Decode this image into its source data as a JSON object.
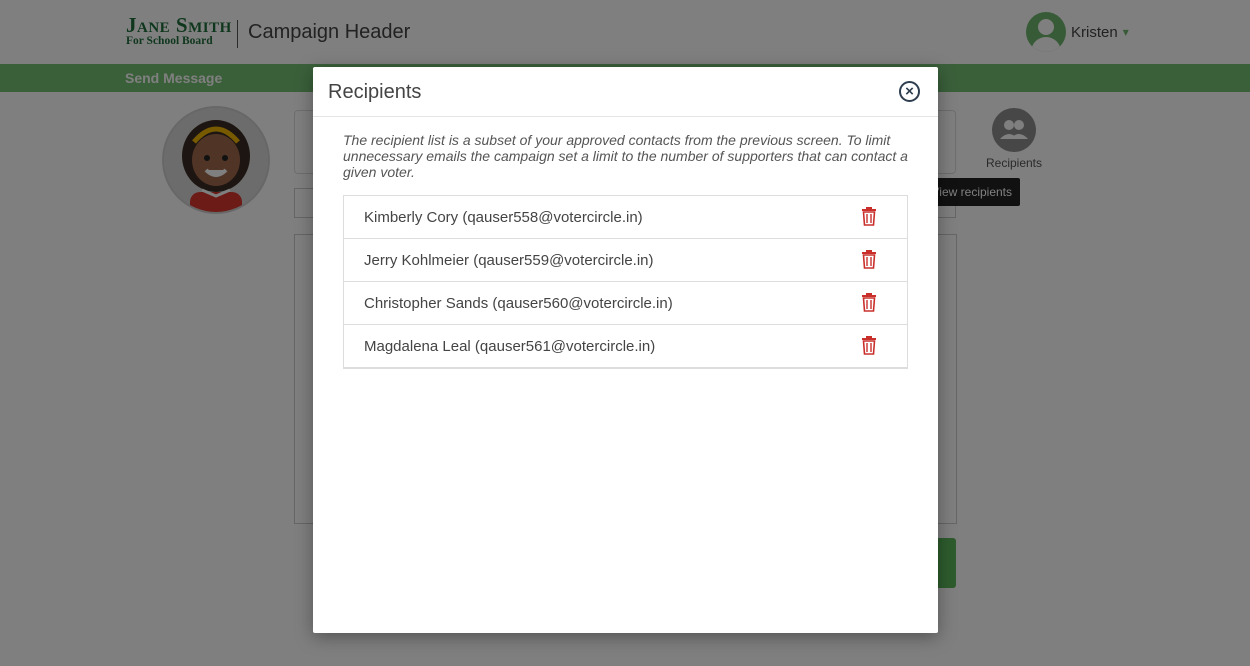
{
  "header": {
    "logo": {
      "line1": "Jane Smith",
      "line2": "For School Board",
      "color": "#1f6e3a"
    },
    "campaign_title": "Campaign Header",
    "user": {
      "name": "Kristen",
      "caret": "▾"
    }
  },
  "nav": {
    "label": "Send Message",
    "color": "#75c175"
  },
  "sidebar_action": {
    "label": "Recipients",
    "tooltip": "View recipients",
    "icon": "users-icon"
  },
  "modal": {
    "title": "Recipients",
    "close_icon": "close-circle-icon",
    "note": "The recipient list is a subset of your approved contacts from the previous screen. To limit unnecessary emails the campaign set a limit to the number of supporters that can contact a given voter.",
    "recipients": [
      {
        "text": "Kimberly Cory (qauser558@votercircle.in)"
      },
      {
        "text": "Jerry Kohlmeier (qauser559@votercircle.in)"
      },
      {
        "text": "Christopher Sands (qauser560@votercircle.in)"
      },
      {
        "text": "Magdalena Leal (qauser561@votercircle.in)"
      }
    ],
    "delete_icon": "trash-icon",
    "delete_color": "#c9302c"
  },
  "colors": {
    "accent": "#75c175",
    "overlay": "rgba(0,0,0,0.5)"
  }
}
